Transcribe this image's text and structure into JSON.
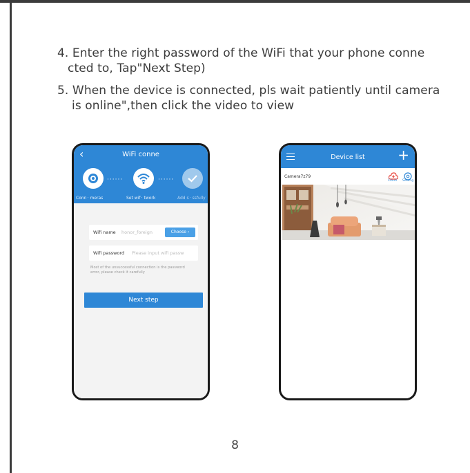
{
  "instructions": {
    "step4_line1": "4. Enter the right password of the WiFi that your phone conne",
    "step4_line2": "cted to, Tap\"Next Step)",
    "step5_line1": "5. When the device is connected, pls wait patiently until camera",
    "step5_line2": "is online\",then click the video to view"
  },
  "phone_wifi": {
    "title": "WiFi conne",
    "steps": [
      "Conn · meras",
      "Set wif · twork",
      "Add s · ssfully"
    ],
    "wifi_name_label": "Wifi name",
    "wifi_name_value": "honor_foreign",
    "choose_label": "Choose ›",
    "wifi_password_label": "Wifi password",
    "wifi_password_placeholder": "Please input wifi passw",
    "hint_line1": "Most of the unsuccessful connection is the password",
    "hint_line2": "error, please check it carefully",
    "next_step_label": "Next step"
  },
  "phone_devices": {
    "title": "Device list",
    "camera_name": "Camera7z79",
    "cloud_label": "Cloud",
    "setting_label": "Setting"
  },
  "colors": {
    "accent": "#2e87d6",
    "cloud_red": "#e8443a"
  },
  "page_number": "8"
}
